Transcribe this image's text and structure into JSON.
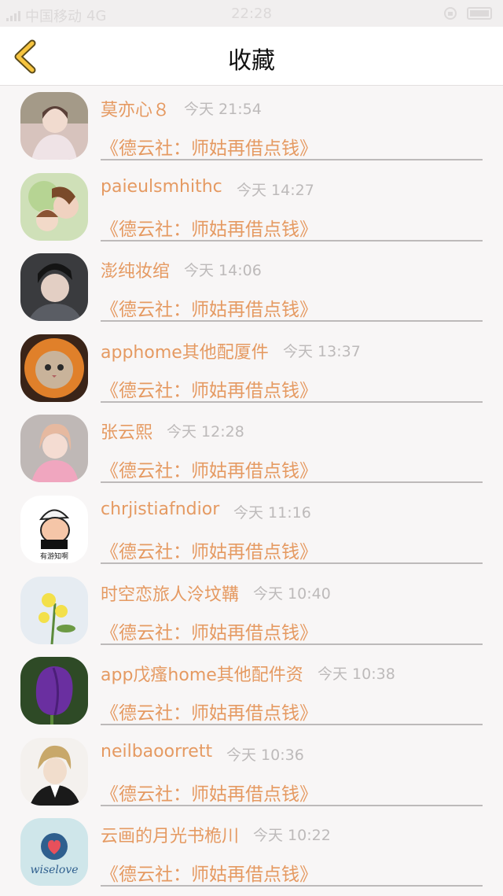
{
  "status_bar": {
    "carrier": "中国移动",
    "network": "4G",
    "time": "22:28"
  },
  "header": {
    "title": "收藏"
  },
  "colors": {
    "accent": "#e59a62",
    "muted": "#bdbaba",
    "back_arrow": "#f6c43f"
  },
  "items": [
    {
      "name": "莫亦心８",
      "time": "今天 21:54",
      "link": "《德云社：师姑再借点钱》"
    },
    {
      "name": "paieulsmhithc",
      "time": "今天 14:27",
      "link": "《德云社：师姑再借点钱》"
    },
    {
      "name": "澎纯妆绾",
      "time": "今天 14:06",
      "link": "《德云社：师姑再借点钱》"
    },
    {
      "name": "apphome其他配厦件",
      "time": "今天 13:37",
      "link": "《德云社：师姑再借点钱》"
    },
    {
      "name": "张云熙",
      "time": "今天 12:28",
      "link": "《德云社：师姑再借点钱》"
    },
    {
      "name": "chrjistiafndior",
      "time": "今天 11:16",
      "link": "《德云社：师姑再借点钱》",
      "avatar_text": "有游知啊"
    },
    {
      "name": "时空恋旅人泠坟鞲",
      "time": "今天 10:40",
      "link": "《德云社：师姑再借点钱》"
    },
    {
      "name": "app戊瘙home其他配件资",
      "time": "今天 10:38",
      "link": "《德云社：师姑再借点钱》"
    },
    {
      "name": "neilbaoorrett",
      "time": "今天 10:36",
      "link": "《德云社：师姑再借点钱》"
    },
    {
      "name": "云画的月光书桅川",
      "time": "今天 10:22",
      "link": "《德云社：师姑再借点钱》",
      "avatar_text": "wiselove"
    }
  ]
}
